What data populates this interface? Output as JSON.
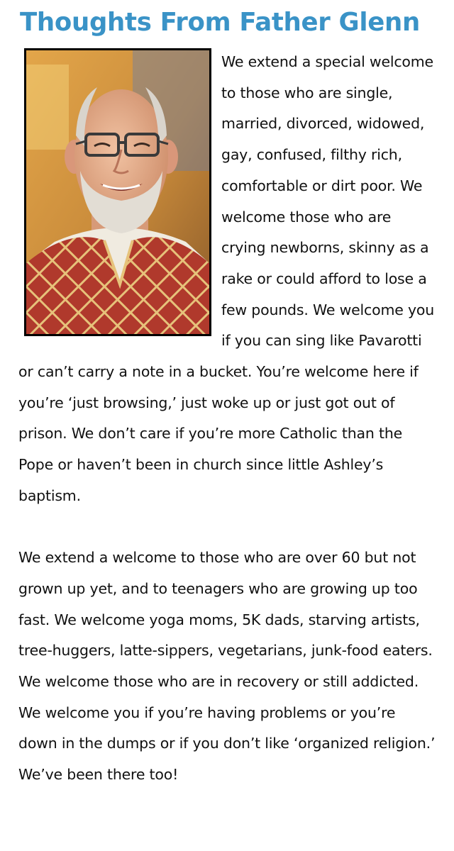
{
  "heading": {
    "title": "Thoughts From Father Glenn"
  },
  "photo": {
    "icon": "priest-portrait-photo",
    "colors": {
      "background": "#c88a3a",
      "skin": "#e7b08f",
      "hair": "#d9d4cc",
      "vestment": "#b0392c",
      "pattern": "#e6c27a",
      "alb": "#f0ebe0",
      "frame": "#000000"
    }
  },
  "article": {
    "paragraph_1": "We extend a special welcome to those who are single, married, divorced, widowed, gay, confused, filthy rich, comfortable or dirt poor. We welcome those who are crying newborns, skinny as a rake or could afford to lose a few pounds. We welcome you if you can sing like Pavarotti or can’t carry a note in a bucket. You’re welcome here if you’re ‘just browsing,’ just woke up or just got out of prison. We don’t care if you’re more Catholic than the Pope or haven’t been in church since little Ashley’s baptism.",
    "paragraph_2": "We extend a welcome to those who are over 60 but not grown up yet, and to teenagers who are growing up too fast. We welcome yoga moms, 5K dads, starving artists, tree-huggers, latte-sippers, vegetarians, junk-food eaters. We welcome those who are in recovery or still addicted. We welcome you if you’re having problems or you’re down in the dumps or if you don’t like ‘organized religion.’ We’ve been there too!"
  },
  "colors": {
    "title": "#3a93c7",
    "text": "#111111",
    "background": "#ffffff"
  }
}
